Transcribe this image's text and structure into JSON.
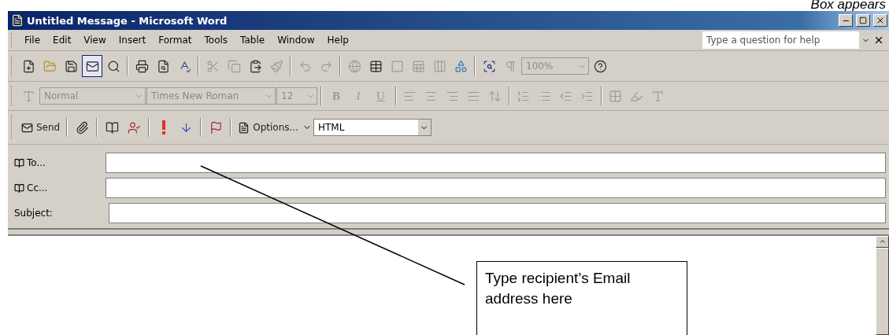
{
  "caption": "Box appears",
  "window": {
    "title": "Untitled Message - Microsoft Word"
  },
  "menu": [
    "File",
    "Edit",
    "View",
    "Insert",
    "Format",
    "Tools",
    "Table",
    "Window",
    "Help"
  ],
  "help_box": {
    "placeholder": "Type a question for help"
  },
  "standard_toolbar": {
    "zoom": {
      "value": "100%",
      "disabled": true
    }
  },
  "formatting_toolbar": {
    "style": {
      "value": "Normal",
      "disabled": true
    },
    "font": {
      "value": "Times New Roman",
      "disabled": true
    },
    "size": {
      "value": "12",
      "disabled": true
    },
    "buttons": [
      {
        "label": "B",
        "kind": "bold"
      },
      {
        "label": "I",
        "kind": "italic"
      },
      {
        "label": "U",
        "kind": "underline"
      }
    ]
  },
  "mail_toolbar": {
    "send": "Send",
    "options": "Options...",
    "format": "HTML"
  },
  "header_fields": [
    {
      "label": "To...",
      "kind": "address"
    },
    {
      "label": "Cc...",
      "kind": "address"
    },
    {
      "label": "Subject:",
      "kind": "plain"
    }
  ],
  "callout": "Type recipient’s Email address here"
}
